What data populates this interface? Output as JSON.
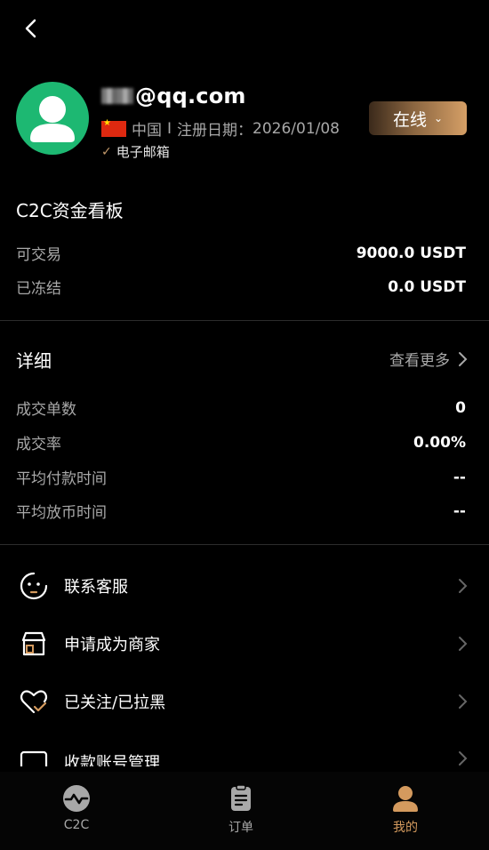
{
  "header": {
    "back_icon": "chevron-left-icon"
  },
  "profile": {
    "email": "@qq.com",
    "country": "中国",
    "separator": "I",
    "register_label": "注册日期：",
    "register_date": "2026/01/08",
    "verification": "电子邮箱",
    "status_label": "在线",
    "status_caret": "⌄",
    "accent_color": "#d59f66",
    "avatar_color": "#1db872"
  },
  "c2c_board": {
    "title": "C2C资金看板",
    "rows": [
      {
        "label": "可交易",
        "value": "9000.0 USDT"
      },
      {
        "label": "已冻结",
        "value": "0.0 USDT"
      }
    ]
  },
  "details": {
    "title": "详细",
    "more_label": "查看更多",
    "rows": [
      {
        "label": "成交单数",
        "value": "0"
      },
      {
        "label": "成交率",
        "value": "0.00%"
      },
      {
        "label": "平均付款时间",
        "value": "--"
      },
      {
        "label": "平均放币时间",
        "value": "--"
      }
    ]
  },
  "menu": [
    {
      "label": "联系客服",
      "icon": "customer-service-icon"
    },
    {
      "label": "申请成为商家",
      "icon": "shop-icon"
    },
    {
      "label": "已关注/已拉黑",
      "icon": "heart-check-icon"
    },
    {
      "label": "收款账号管理",
      "icon": "payment-account-icon"
    }
  ],
  "tabbar": {
    "tabs": [
      {
        "label": "C2C",
        "icon": "c2c-icon",
        "active": false
      },
      {
        "label": "订单",
        "icon": "orders-icon",
        "active": false
      },
      {
        "label": "我的",
        "icon": "profile-icon",
        "active": true
      }
    ]
  }
}
